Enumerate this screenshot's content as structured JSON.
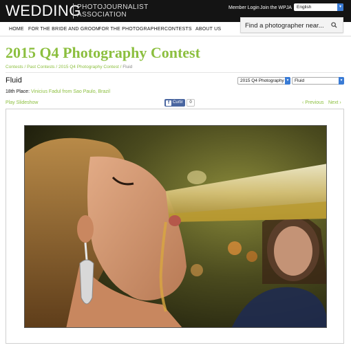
{
  "header": {
    "logo_main": "WEDDING",
    "logo_sub_line1": "PHOTOJOURNALIST",
    "logo_sub_line2": "ASSOCIATION",
    "member_login": "Member Login",
    "join": "Join the WPJA",
    "language": "English"
  },
  "nav": {
    "items": [
      "HOME",
      "FOR THE BRIDE AND GROOM",
      "FOR THE PHOTOGRAPHER",
      "CONTESTS",
      "ABOUT US"
    ],
    "search_placeholder": "Find a photographer near..."
  },
  "page": {
    "title": "2015 Q4 Photography Contest",
    "breadcrumb": [
      "Contests",
      "Past Contests",
      "2015 Q4 Photography Contest",
      "Fluid"
    ],
    "breadcrumb_sep": " / ",
    "photo_title": "Fluid",
    "contest_select": "2015 Q4 Photography",
    "category_select": "Fluid",
    "place_label": "18th Place:",
    "place_name": "Vinicius Fadul from Sao Paulo, Brazil",
    "slideshow": "Play Slideshow",
    "fb_like": "Curtir",
    "fb_count": "0",
    "previous": "‹ Previous",
    "next": "Next ›"
  },
  "colors": {
    "accent_green": "#8cbf3f",
    "header_bg": "#141414",
    "select_blue": "#3a7bd5",
    "facebook_blue": "#4a66a0"
  },
  "icons": {
    "search": "search-icon",
    "dropdown": "chevron-down-icon",
    "facebook": "facebook-icon"
  }
}
